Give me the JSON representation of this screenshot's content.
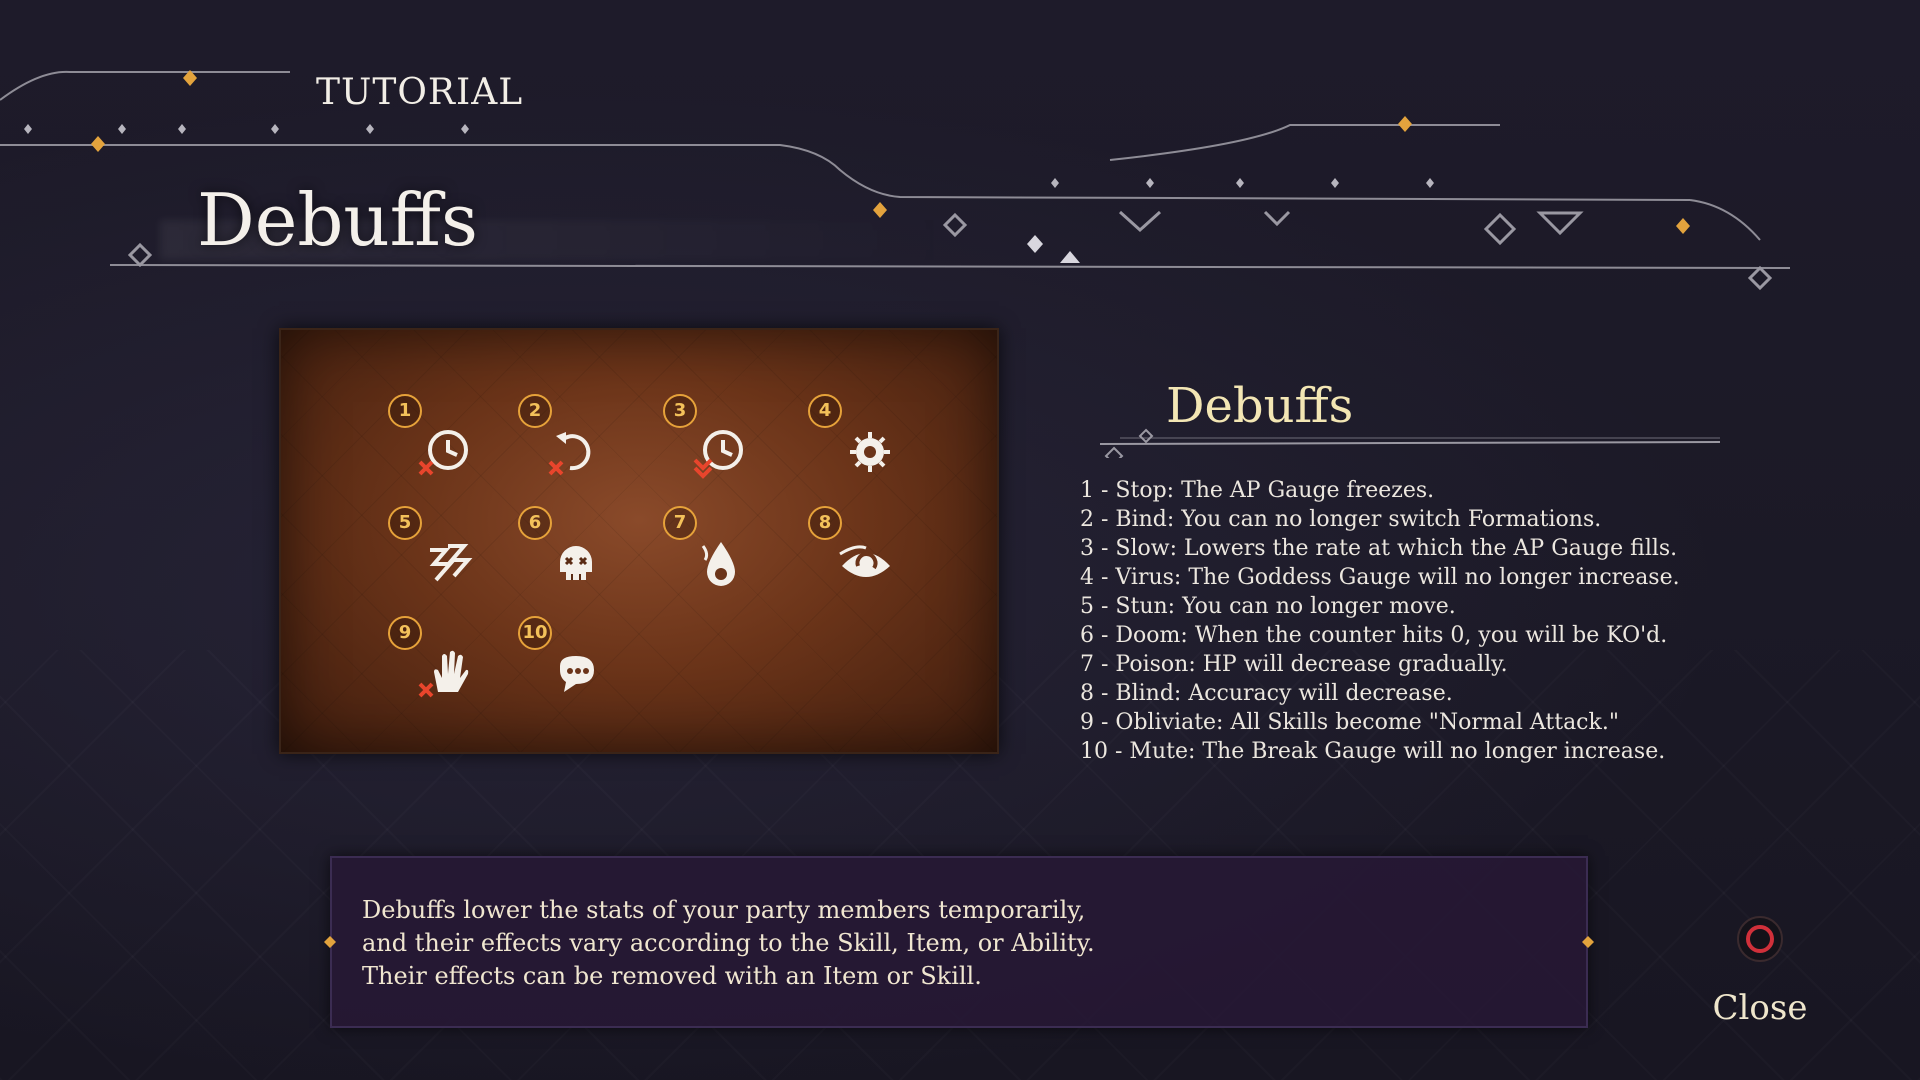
{
  "header": {
    "section_label": "TUTORIAL",
    "page_title": "Debuffs"
  },
  "panel": {
    "debuffs": [
      {
        "number": "1",
        "icon": "stop-clock-icon"
      },
      {
        "number": "2",
        "icon": "bind-arrows-icon"
      },
      {
        "number": "3",
        "icon": "slow-clock-icon"
      },
      {
        "number": "4",
        "icon": "virus-icon"
      },
      {
        "number": "5",
        "icon": "stun-lightning-icon"
      },
      {
        "number": "6",
        "icon": "doom-skull-icon"
      },
      {
        "number": "7",
        "icon": "poison-drop-icon"
      },
      {
        "number": "8",
        "icon": "blind-eye-icon"
      },
      {
        "number": "9",
        "icon": "obliviate-hand-icon"
      },
      {
        "number": "10",
        "icon": "mute-speech-icon"
      }
    ]
  },
  "details": {
    "heading": "Debuffs",
    "effects": [
      "1 - Stop: The AP Gauge freezes.",
      "2 - Bind: You can no longer switch Formations.",
      "3 - Slow: Lowers the rate at which the AP Gauge fills.",
      "4 - Virus: The Goddess Gauge will no longer increase.",
      "5 - Stun: You can no longer move.",
      "6 - Doom: When the counter hits 0, you will be KO'd.",
      "7 - Poison: HP will decrease gradually.",
      "8 - Blind: Accuracy will decrease.",
      "9 - Obliviate: All Skills become \"Normal Attack.\"",
      "10 - Mute: The Break Gauge will no longer increase."
    ]
  },
  "description": {
    "lines": [
      "Debuffs lower the stats of your party members temporarily,",
      "and their effects vary according to the Skill, Item, or Ability.",
      "Their effects can be removed with an Item or Skill."
    ]
  },
  "footer": {
    "close_label": "Close",
    "close_icon": "circle-button-icon"
  },
  "colors": {
    "accent_gold": "#e6a23a",
    "heading_cream": "#f3e6b4",
    "close_red": "#d0303a",
    "panel_bg": "#6b3419"
  }
}
